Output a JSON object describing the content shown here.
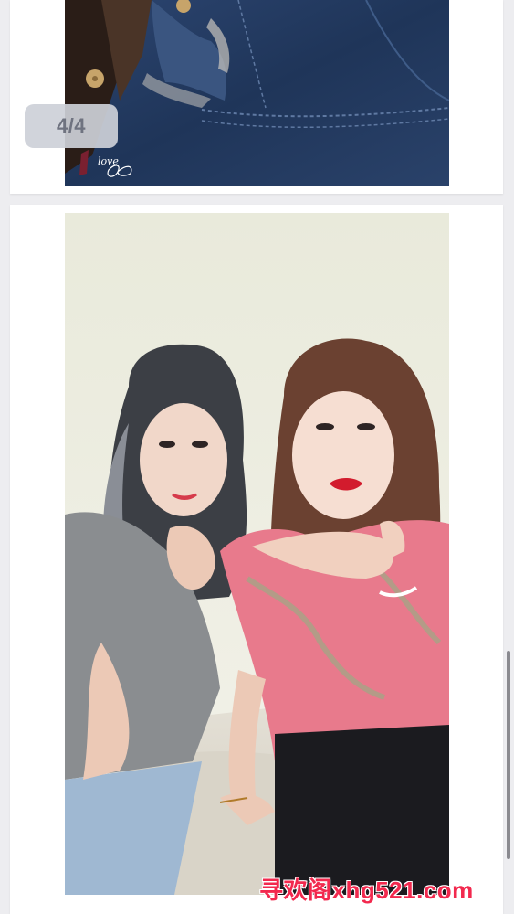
{
  "gallery": {
    "counter": "4/4"
  },
  "watermark": {
    "text": "寻欢阁xhg521.com"
  },
  "colors": {
    "background": "#ededf0",
    "card": "#ffffff",
    "badge": "#cdd0d8",
    "watermark": "#f2294e"
  },
  "images": {
    "top_photo": "photo-denim-jacket",
    "bottom_photo": "photo-two-women-selfie"
  }
}
